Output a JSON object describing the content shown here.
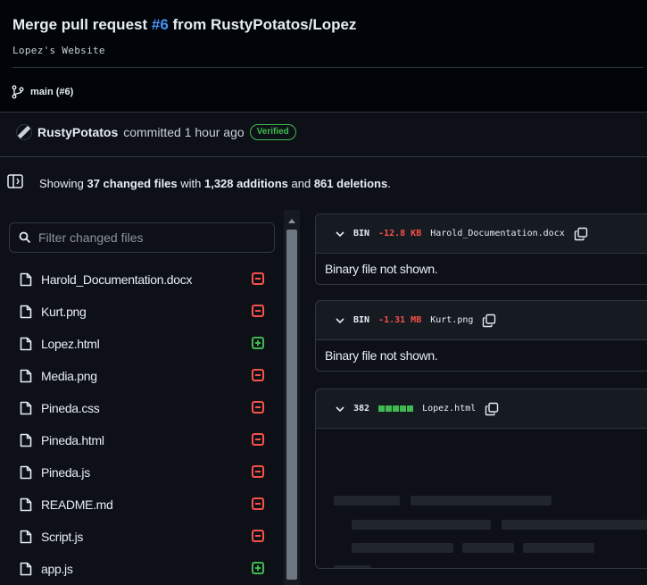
{
  "header": {
    "title_prefix": "Merge pull request ",
    "pr_number": "#6",
    "title_suffix": " from RustyPotatos/Lopez",
    "description": "Lopez's Website",
    "branch": "main (#6)"
  },
  "commit": {
    "author": "RustyPotatos",
    "text": "committed 1 hour ago",
    "badge": "Verified"
  },
  "summary": {
    "prefix": "Showing ",
    "changed_files": "37 changed files",
    "with": " with ",
    "additions": "1,328 additions",
    "and": " and ",
    "deletions": "861 deletions",
    "suffix": "."
  },
  "filter": {
    "placeholder": "Filter changed files"
  },
  "files": [
    {
      "name": "Harold_Documentation.docx",
      "status": "deleted"
    },
    {
      "name": "Kurt.png",
      "status": "deleted"
    },
    {
      "name": "Lopez.html",
      "status": "added"
    },
    {
      "name": "Media.png",
      "status": "deleted"
    },
    {
      "name": "Pineda.css",
      "status": "deleted"
    },
    {
      "name": "Pineda.html",
      "status": "deleted"
    },
    {
      "name": "Pineda.js",
      "status": "deleted"
    },
    {
      "name": "README.md",
      "status": "deleted"
    },
    {
      "name": "Script.js",
      "status": "deleted"
    },
    {
      "name": "app.js",
      "status": "added"
    }
  ],
  "diffs": [
    {
      "type": "BIN",
      "delta": "-12.8 KB",
      "filename": "Harold_Documentation.docx",
      "body": "Binary file not shown."
    },
    {
      "type": "BIN",
      "delta": "-1.31 MB",
      "filename": "Kurt.png",
      "body": "Binary file not shown."
    },
    {
      "additions": "382",
      "filename": "Lopez.html"
    }
  ],
  "colors": {
    "accent_link": "#4493f8",
    "added": "#3fb950",
    "deleted": "#f85149",
    "background": "#0d1117"
  },
  "icons": {
    "branch": "git-branch-icon",
    "panel": "sidebar-toggle-icon",
    "search": "search-icon",
    "file": "file-icon",
    "copy": "copy-icon",
    "chevron": "chevron-down-icon"
  }
}
